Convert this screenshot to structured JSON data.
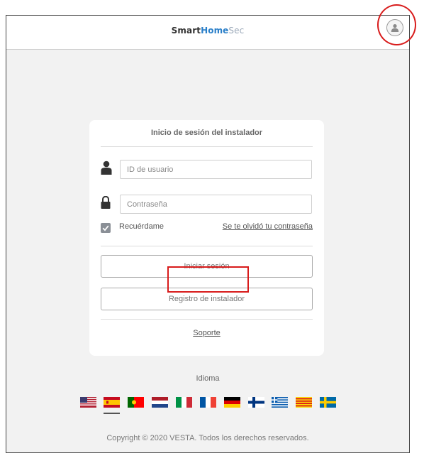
{
  "app": {
    "brand": {
      "part1": "Smart",
      "part2": "Home",
      "part3": "Sec",
      "color_part2": "#2a7fc9",
      "color_part3": "#9aa8b8"
    }
  },
  "header": {
    "user_icon": "user-circle-icon"
  },
  "login": {
    "title": "Inicio de sesión del instalador",
    "username_placeholder": "ID de usuario",
    "username_value": "",
    "password_placeholder": "Contraseña",
    "password_value": "",
    "remember_label": "Recuérdame",
    "remember_checked": true,
    "forgot_link": "Se te olvidó tu contraseña",
    "login_button": "Iniciar sesión",
    "register_button": "Registro de instalador",
    "support_link": "Soporte",
    "user_icon": "person-icon",
    "lock_icon": "lock-icon"
  },
  "language": {
    "label": "Idioma",
    "selected": "es",
    "flags": [
      "us",
      "es",
      "pt",
      "nl",
      "it",
      "fr",
      "de",
      "fi",
      "gr",
      "cat",
      "se"
    ]
  },
  "footer": {
    "copyright": "Copyright © 2020 VESTA. Todos los derechos reservados."
  },
  "colors": {
    "accent_highlight": "#d81b1b",
    "background": "#f2f2f2"
  }
}
